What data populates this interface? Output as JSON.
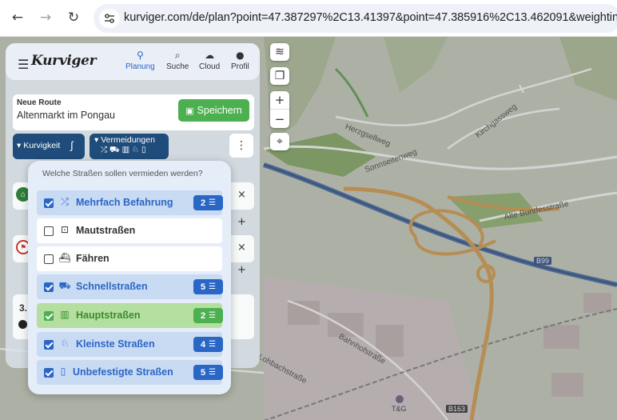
{
  "browser": {
    "url": "kurviger.com/de/plan?point=47.387297%2C13.41397&point=47.385916%2C13.462091&weighting=cu"
  },
  "app": {
    "logo": "Kurviger",
    "nav": [
      {
        "label": "Planung",
        "icon": "route-icon",
        "active": true
      },
      {
        "label": "Suche",
        "icon": "search-icon"
      },
      {
        "label": "Cloud",
        "icon": "cloud-icon"
      },
      {
        "label": "Profil",
        "icon": "person-icon"
      }
    ],
    "route": {
      "title": "Neue Route",
      "name": "Altenmarkt im Pongau"
    },
    "save_label": "Speichern",
    "curviness_label": "Kurvigkeit",
    "avoid_label": "Vermeidungen",
    "summary_prefix": "3."
  },
  "map": {
    "streets": [
      "Herzgsellweg",
      "Sonnseitenweg",
      "Kirchgassweg",
      "Alte Bundesstraße",
      "Bahnhofstraße",
      "Lohbachstraße"
    ],
    "road_ids": [
      "B99",
      "B163"
    ],
    "poi_label": "T&G"
  },
  "popup": {
    "title": "Welche Straßen sollen vermieden werden?",
    "options": [
      {
        "label": "Mehrfach Befahrung",
        "checked": true,
        "count": "2",
        "style": "checked",
        "icon": "shuffle-icon"
      },
      {
        "label": "Mautstraßen",
        "checked": false,
        "style": "white",
        "icon": "toll-icon"
      },
      {
        "label": "Fähren",
        "checked": false,
        "style": "white",
        "icon": "ferry-icon"
      },
      {
        "label": "Schnellstraßen",
        "checked": true,
        "count": "5",
        "style": "checked",
        "icon": "car-icon"
      },
      {
        "label": "Hauptstraßen",
        "checked": true,
        "count": "2",
        "style": "green",
        "icon": "road-icon"
      },
      {
        "label": "Kleinste Straßen",
        "checked": true,
        "count": "4",
        "style": "checked",
        "icon": "narrow-road-icon"
      },
      {
        "label": "Unbefestigte Straßen",
        "checked": true,
        "count": "5",
        "style": "checked",
        "icon": "gravel-icon"
      }
    ]
  },
  "colors": {
    "accent": "#2a66c6",
    "green": "#4caf50",
    "chip": "#1f4c7a"
  }
}
